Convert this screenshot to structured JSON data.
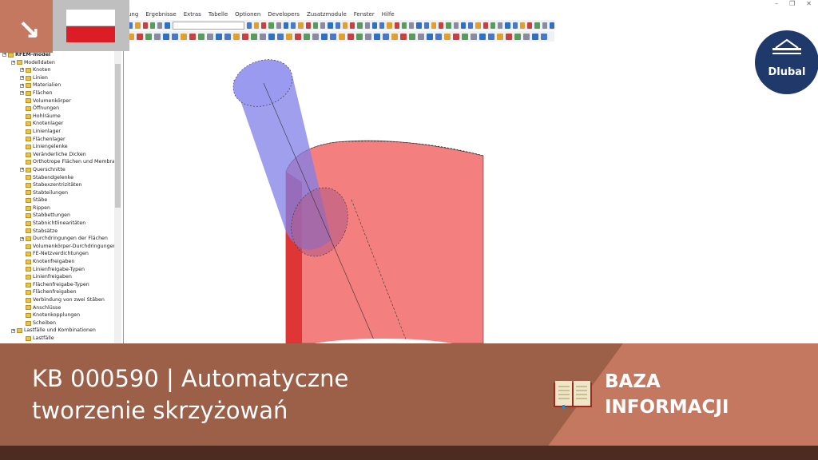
{
  "window": {
    "controls": [
      "–",
      "❐",
      "✕"
    ]
  },
  "menu": [
    "ung",
    "Ergebnisse",
    "Extras",
    "Tabelle",
    "Optionen",
    "Developers",
    "Zusatzmodule",
    "Fenster",
    "Hilfe"
  ],
  "tree": {
    "root": "RFEM-model",
    "group1": "Modelldaten",
    "items": [
      "Knoten",
      "Linien",
      "Materialien",
      "Flächen",
      "Volumenkörper",
      "Öffnungen",
      "Hohlräume",
      "Knotenlager",
      "Linienlager",
      "Flächenlager",
      "Liniengelenke",
      "Veränderliche Dicken",
      "Orthotrope Flächen und Membrar",
      "Querschnitte",
      "Stabendgelenke",
      "Stabexzentrizitäten",
      "Stabteilungen",
      "Stäbe",
      "Rippen",
      "Stabbettungen",
      "Stabnichtlinearitäten",
      "Stabsätze",
      "Durchdringungen der Flächen",
      "Volumenkörper-Durchdringunger",
      "FE-Netzverdichtungen",
      "Knotenfreigaben",
      "Linienfreigabe-Typen",
      "Linienfreigaben",
      "Flächenfreigabe-Typen",
      "Flächenfreigaben",
      "Verbindung von zwei Stäben",
      "Anschlüsse",
      "Knotenkopplungen",
      "Scheiben"
    ],
    "expandable": [
      0,
      1,
      2,
      3,
      13,
      22
    ],
    "group2": "Lastfälle und Kombinationen",
    "sub2": "Lastfälle"
  },
  "logo": "Dlubal",
  "banner": {
    "title_line1": "KB 000590 | Automatyczne",
    "title_line2": "tworzenie skrzyżowań",
    "category_line1": "BAZA",
    "category_line2": "INFORMACJI"
  },
  "colors": {
    "accent": "#c47860",
    "dark_accent": "#9c5f48",
    "footer": "#4e2b20",
    "logo": "#1f3a6a"
  }
}
